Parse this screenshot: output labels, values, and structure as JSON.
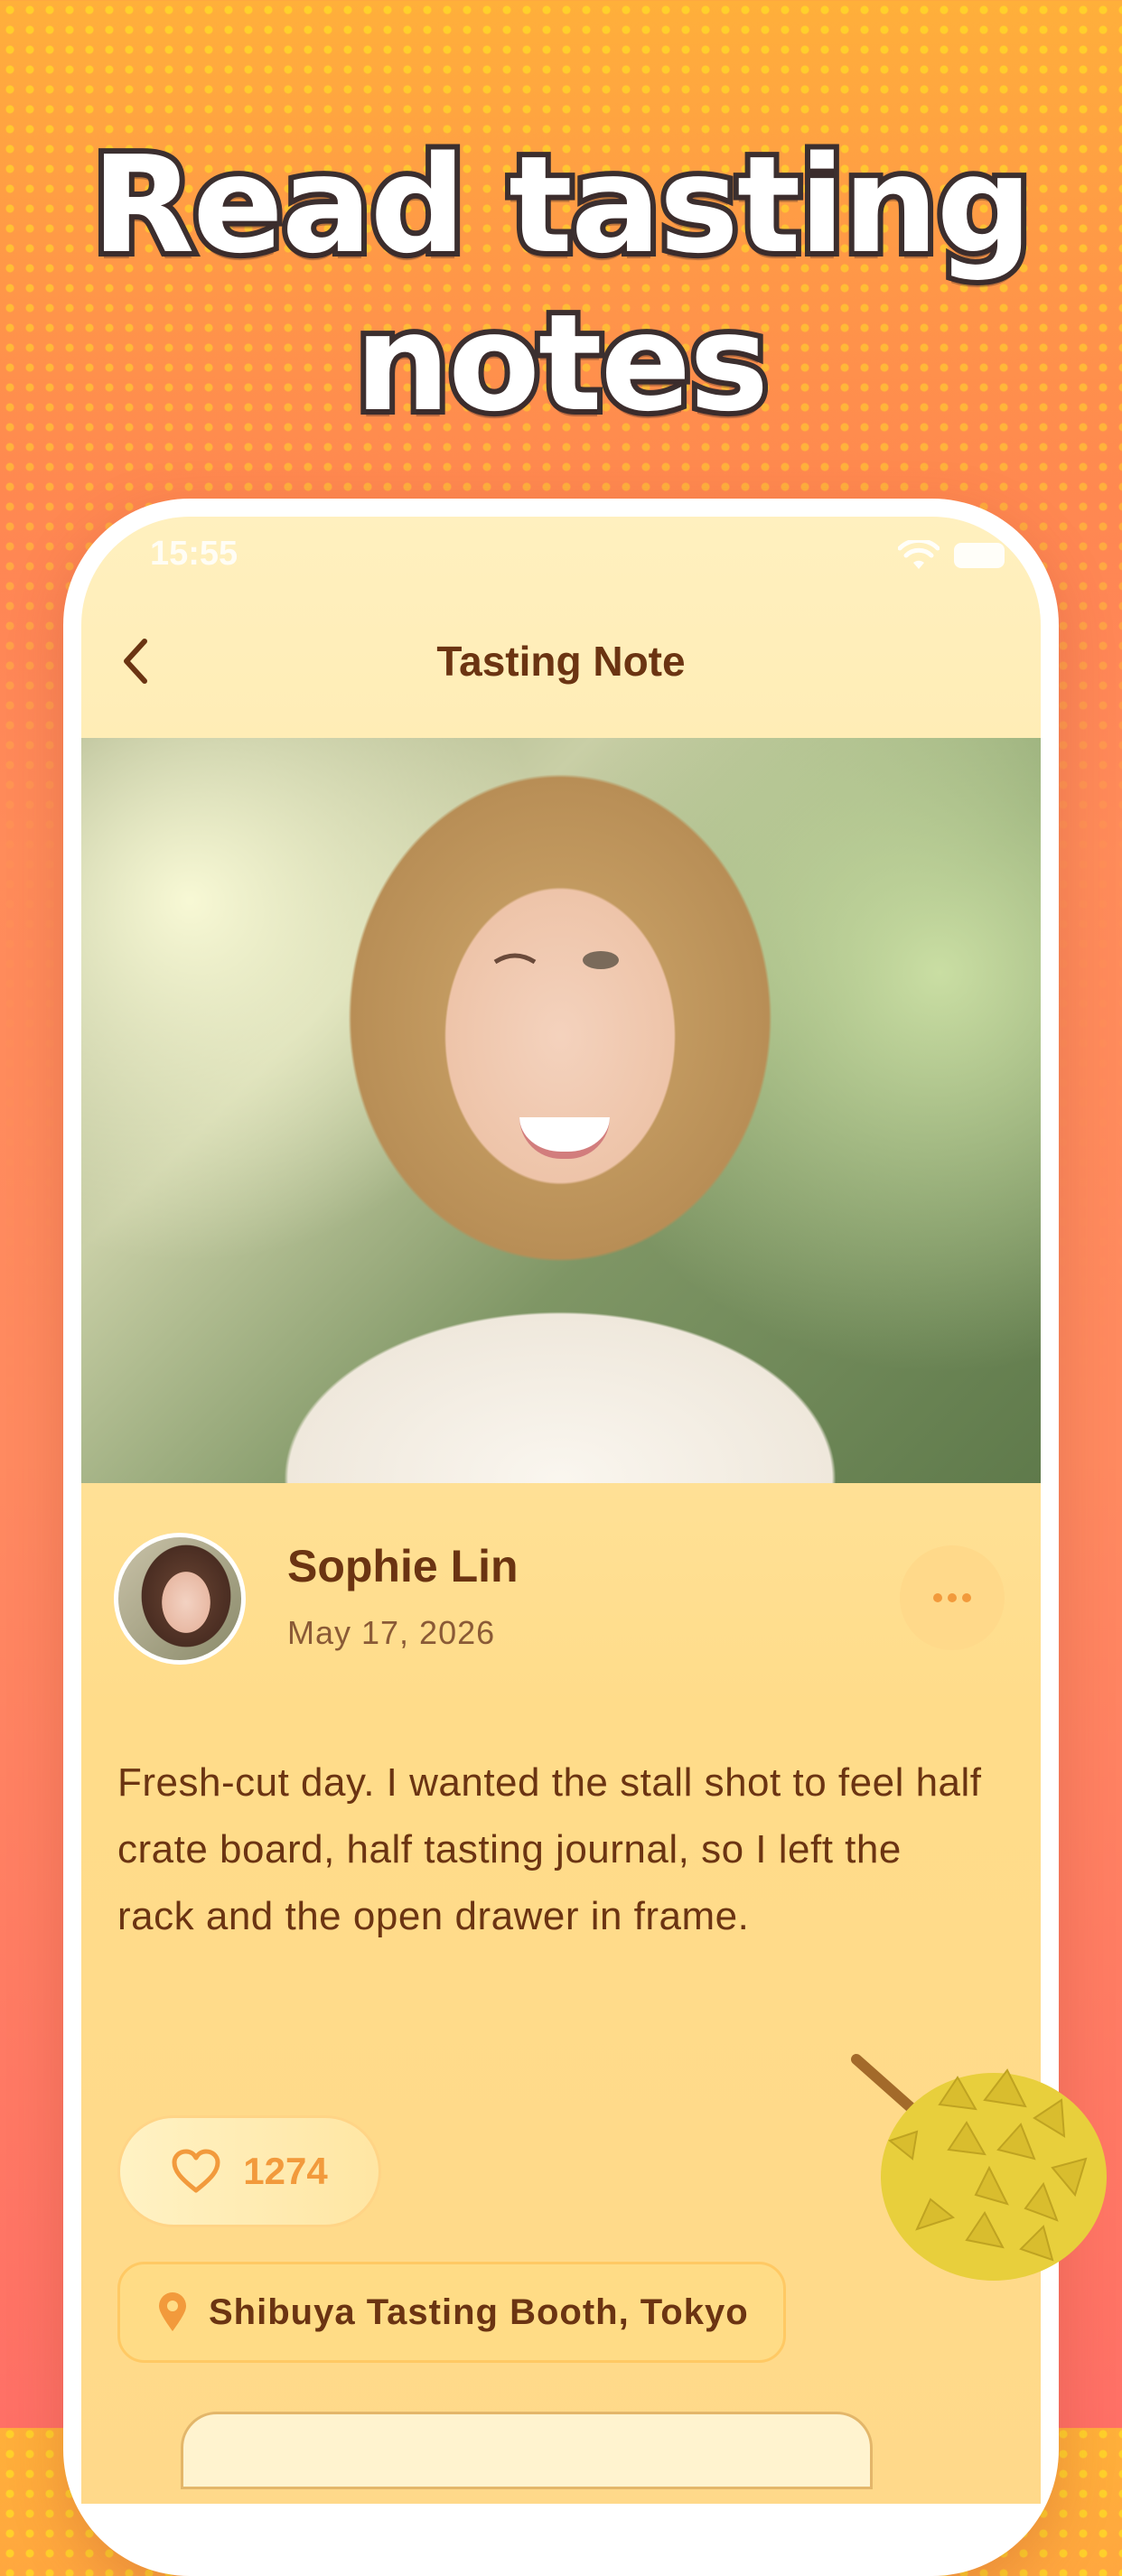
{
  "headline": {
    "line1": "Read tasting",
    "line2": "notes"
  },
  "status_bar": {
    "time": "15:55"
  },
  "navbar": {
    "title": "Tasting Note"
  },
  "author": {
    "name": "Sophie Lin",
    "date": "May 17, 2026"
  },
  "note": {
    "text": "Fresh-cut day. I wanted the stall shot to feel half crate board, half tasting journal, so I left the rack and the open drawer in frame."
  },
  "likes": {
    "count": "1274"
  },
  "location": {
    "label": "Shibuya Tasting Booth, Tokyo"
  },
  "colors": {
    "accent": "#f29a3c",
    "title_text": "#6b3412",
    "screen_bg": "#ffe6a3"
  }
}
